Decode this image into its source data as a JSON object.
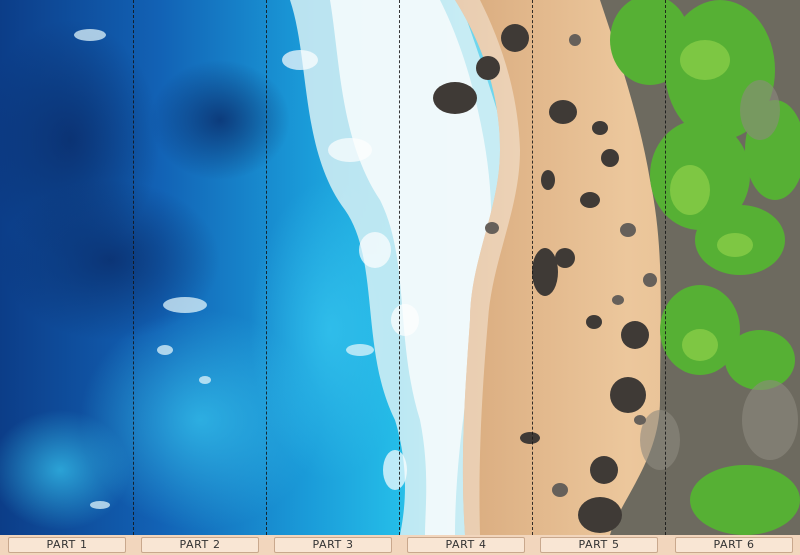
{
  "image": {
    "subject": "aerial-beach-panorama",
    "colors": {
      "deep_ocean": "#0d3f8a",
      "ocean": "#1674c4",
      "shallow_water": "#23b7e6",
      "surf": "#eaf6f7",
      "sand": "#e8bf93",
      "rock": "#4a4541",
      "vegetation": "#5fb83a",
      "cliff": "#6e6b60"
    }
  },
  "panels": [
    {
      "label": "PART 1"
    },
    {
      "label": "PART 2"
    },
    {
      "label": "PART 3"
    },
    {
      "label": "PART 4"
    },
    {
      "label": "PART 5"
    },
    {
      "label": "PART 6"
    }
  ]
}
